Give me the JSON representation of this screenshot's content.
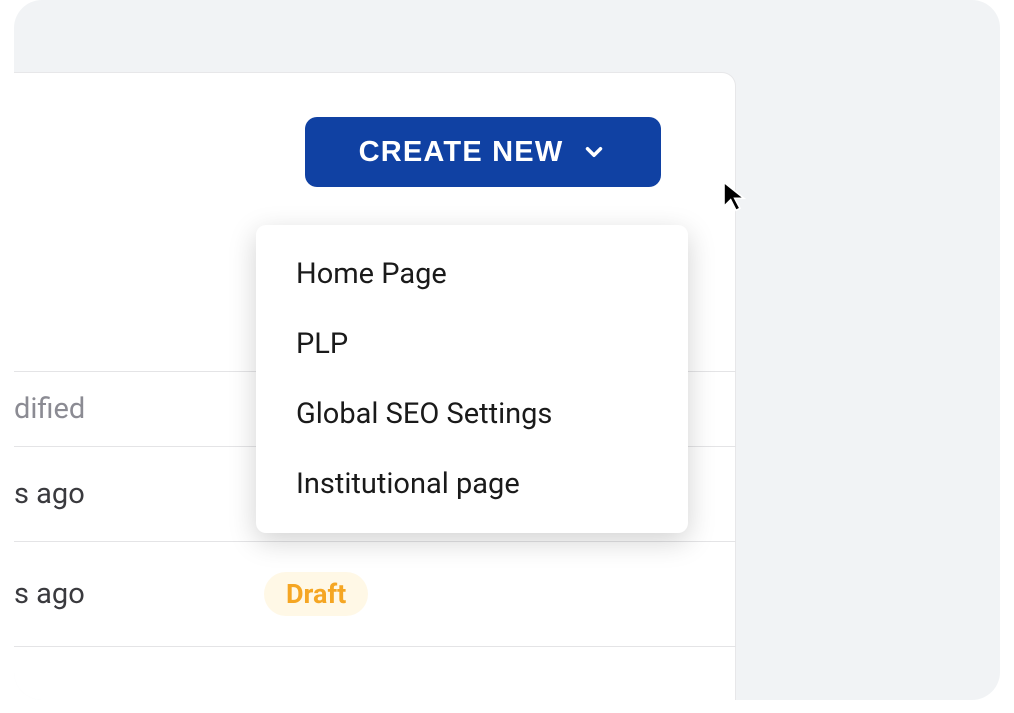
{
  "create_button": {
    "label": "CREATE NEW"
  },
  "dropdown": {
    "items": [
      {
        "label": "Home Page"
      },
      {
        "label": "PLP"
      },
      {
        "label": "Global SEO Settings"
      },
      {
        "label": "Institutional page"
      }
    ]
  },
  "table": {
    "header_fragment": "dified",
    "rows": [
      {
        "time_fragment": "s ago",
        "status": ""
      },
      {
        "time_fragment": "s ago",
        "status": "Draft"
      }
    ]
  },
  "colors": {
    "primary": "#1041a3",
    "draft_bg": "#fff8e6",
    "draft_text": "#f5a623"
  }
}
